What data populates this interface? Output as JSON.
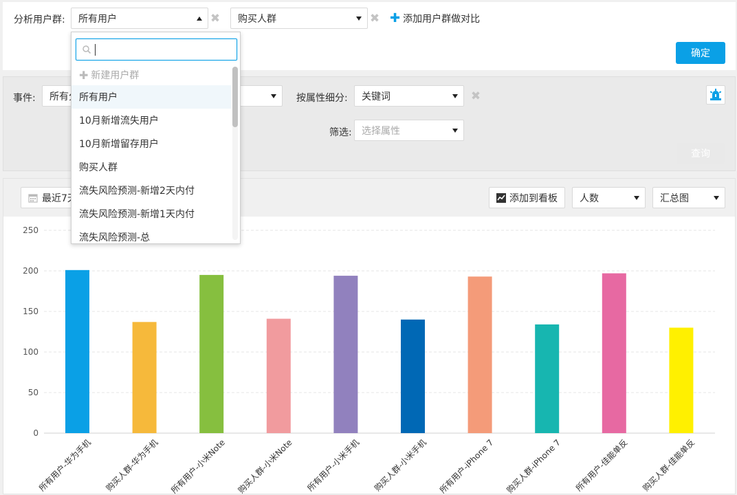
{
  "top": {
    "analyze_label": "分析用户群:",
    "group1_value": "所有用户",
    "group2_value": "购买人群",
    "add_compare_label": "添加用户群做对比",
    "confirm_label": "确定"
  },
  "dropdown": {
    "search_value": "",
    "create_label": "新建用户群",
    "items": [
      "所有用户",
      "10月新增流失用户",
      "10月新增留存用户",
      "购买人群",
      "流失风险预测-新增2天内付",
      "流失风险预测-新增1天内付",
      "流失风险预测-总"
    ]
  },
  "event_panel": {
    "event_label": "事件:",
    "event_value": "所有分",
    "breakdown_label": "按属性细分:",
    "breakdown_value": "关键词",
    "filter_label": "筛选:",
    "filter_placeholder": "选择属性",
    "query_label": "查询"
  },
  "chart_toolbar": {
    "date_label": "最近7天",
    "add_to_board_label": "添加到看板",
    "metric_value": "人数",
    "view_value": "汇总图"
  },
  "colors": {
    "accent": "#0aa0e6",
    "bars": [
      "#0aa0e6",
      "#f6b93b",
      "#86bf3f",
      "#f19b9e",
      "#9181be",
      "#0068b5",
      "#f49b79",
      "#17b6b0",
      "#e769a2",
      "#fff000"
    ]
  },
  "chart_data": {
    "type": "bar",
    "categories": [
      "所有用户-华为手机",
      "购买人群-华为手机",
      "所有用户-小米Note",
      "购买人群-小米Note",
      "所有用户-小米手机",
      "购买人群-小米手机",
      "所有用户-iPhone 7",
      "购买人群-iPhone 7",
      "所有用户-佳能单反",
      "购买人群-佳能单反"
    ],
    "values": [
      201,
      137,
      195,
      141,
      194,
      140,
      193,
      134,
      197,
      130
    ],
    "ylim": [
      0,
      250
    ],
    "yticks": [
      0,
      50,
      100,
      150,
      200,
      250
    ],
    "grid": true,
    "title": "",
    "xlabel": "",
    "ylabel": ""
  }
}
